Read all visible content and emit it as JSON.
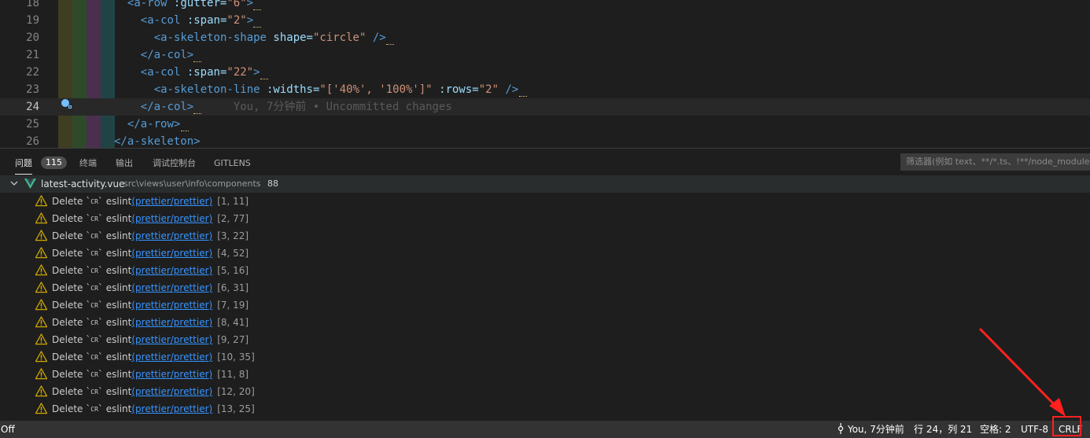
{
  "editor": {
    "line_numbers": [
      "18",
      "19",
      "20",
      "21",
      "22",
      "23",
      "24",
      "25",
      "26"
    ],
    "lines": [
      {
        "indent": "    ",
        "parts": [
          {
            "t": "tag",
            "v": "<a-row "
          },
          {
            "t": "attr",
            "v": ":gutter="
          },
          {
            "t": "str",
            "v": "\"6\""
          },
          {
            "t": "tag",
            "v": ">"
          }
        ]
      },
      {
        "indent": "      ",
        "parts": [
          {
            "t": "tag",
            "v": "<a-col "
          },
          {
            "t": "attr",
            "v": ":span="
          },
          {
            "t": "str",
            "v": "\"2\""
          },
          {
            "t": "tag",
            "v": ">"
          }
        ]
      },
      {
        "indent": "        ",
        "parts": [
          {
            "t": "tag",
            "v": "<a-skeleton-shape "
          },
          {
            "t": "attr",
            "v": "shape="
          },
          {
            "t": "str",
            "v": "\"circle\""
          },
          {
            "t": "tag",
            "v": " />"
          }
        ]
      },
      {
        "indent": "      ",
        "parts": [
          {
            "t": "tag",
            "v": "</a-col>"
          }
        ]
      },
      {
        "indent": "      ",
        "parts": [
          {
            "t": "tag",
            "v": "<a-col "
          },
          {
            "t": "attr",
            "v": ":span="
          },
          {
            "t": "str",
            "v": "\"22\""
          },
          {
            "t": "tag",
            "v": ">"
          }
        ]
      },
      {
        "indent": "        ",
        "parts": [
          {
            "t": "tag",
            "v": "<a-skeleton-line "
          },
          {
            "t": "attr",
            "v": ":widths="
          },
          {
            "t": "str",
            "v": "\"['40%', '100%']\""
          },
          {
            "t": "attr",
            "v": " :rows="
          },
          {
            "t": "str",
            "v": "\"2\""
          },
          {
            "t": "tag",
            "v": " />"
          }
        ]
      },
      {
        "indent": "      ",
        "parts": [
          {
            "t": "tag",
            "v": "</a-col>"
          }
        ]
      },
      {
        "indent": "    ",
        "parts": [
          {
            "t": "tag",
            "v": "</a-row>"
          }
        ]
      },
      {
        "indent": "  ",
        "parts": [
          {
            "t": "tag",
            "v": "</a-skeleton>"
          }
        ]
      }
    ],
    "blame": "You, 7分钟前 • Uncommitted changes"
  },
  "panel": {
    "tabs": [
      "问题",
      "终端",
      "输出",
      "调试控制台",
      "GITLENS"
    ],
    "problem_count": "115",
    "filter_placeholder": "筛选器(例如 text、**/*.ts、!**/node_modules/**)",
    "file": {
      "name": "latest-activity.vue",
      "path": "src\\views\\user\\info\\components",
      "count": "88"
    },
    "problems": [
      {
        "pos": "[1, 11]"
      },
      {
        "pos": "[2, 77]"
      },
      {
        "pos": "[3, 22]"
      },
      {
        "pos": "[4, 52]"
      },
      {
        "pos": "[5, 16]"
      },
      {
        "pos": "[6, 31]"
      },
      {
        "pos": "[7, 19]"
      },
      {
        "pos": "[8, 41]"
      },
      {
        "pos": "[9, 27]"
      },
      {
        "pos": "[10, 35]"
      },
      {
        "pos": "[11, 8]"
      },
      {
        "pos": "[12, 20]"
      },
      {
        "pos": "[13, 25]"
      }
    ],
    "problem_text": {
      "delete": "Delete `",
      "cr": "CR",
      "close": "`",
      "source": "eslint",
      "rule": "(prettier/prettier)"
    }
  },
  "status": {
    "left": "Off",
    "blame": "You, 7分钟前",
    "position": "行 24，列 21",
    "spaces": "空格: 2",
    "encoding": "UTF-8",
    "eol": "CRLF"
  },
  "colors": {
    "accent_blue": "#3794ff",
    "warning": "#cca700",
    "highlight": "#ff2020"
  }
}
